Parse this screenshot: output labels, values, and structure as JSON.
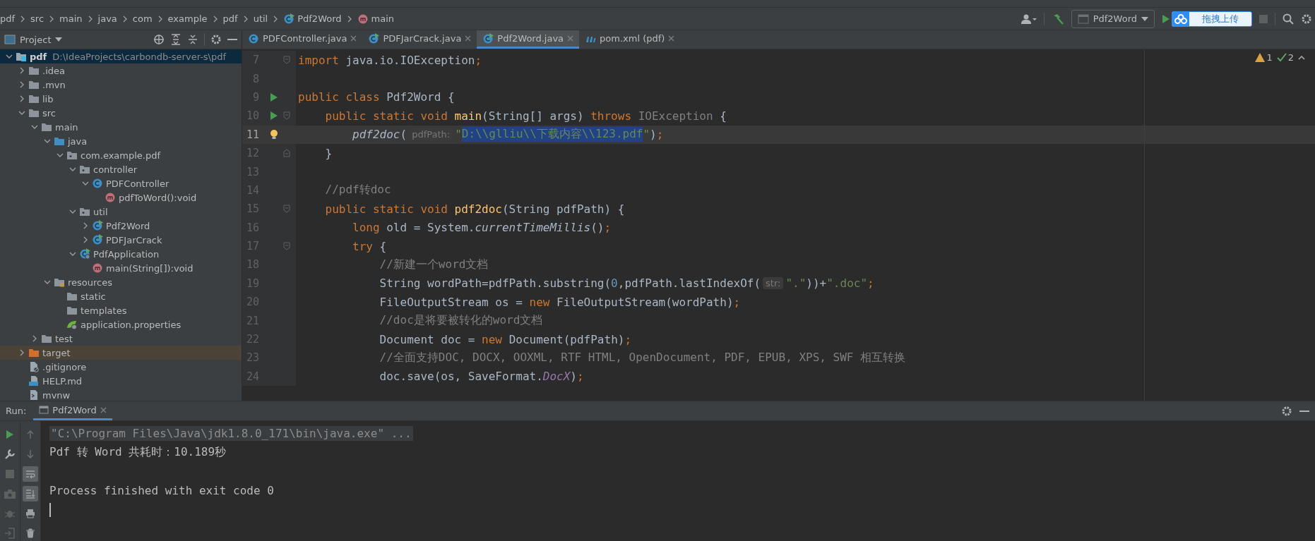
{
  "breadcrumbs": [
    {
      "label": "pdf",
      "kind": "plain"
    },
    {
      "label": "src",
      "kind": "plain"
    },
    {
      "label": "main",
      "kind": "plain"
    },
    {
      "label": "java",
      "kind": "plain"
    },
    {
      "label": "com",
      "kind": "plain"
    },
    {
      "label": "example",
      "kind": "plain"
    },
    {
      "label": "pdf",
      "kind": "plain"
    },
    {
      "label": "util",
      "kind": "plain"
    },
    {
      "label": "Pdf2Word",
      "kind": "runnable-class"
    },
    {
      "label": "main",
      "kind": "method"
    }
  ],
  "toolbar": {
    "run_config": "Pdf2Word",
    "upload_button": "拖拽上传"
  },
  "project_panel": {
    "title": "Project",
    "tree": [
      {
        "label": "pdf",
        "path": "D:\\IdeaProjects\\carbondb-server-s\\pdf",
        "kind": "module",
        "expanded": true,
        "selected": true,
        "children": [
          {
            "label": ".idea",
            "kind": "folder",
            "expanded": false,
            "selected": false
          },
          {
            "label": ".mvn",
            "kind": "folder",
            "expanded": false,
            "selected": false
          },
          {
            "label": "lib",
            "kind": "folder",
            "expanded": false,
            "selected": false
          },
          {
            "label": "src",
            "kind": "folder",
            "expanded": true,
            "selected": false,
            "children": [
              {
                "label": "main",
                "kind": "folder",
                "expanded": true,
                "selected": false,
                "children": [
                  {
                    "label": "java",
                    "kind": "source-folder",
                    "expanded": true,
                    "selected": false,
                    "children": [
                      {
                        "label": "com.example.pdf",
                        "kind": "package",
                        "expanded": true,
                        "selected": false,
                        "children": [
                          {
                            "label": "controller",
                            "kind": "package",
                            "expanded": true,
                            "selected": false,
                            "children": [
                              {
                                "label": "PDFController",
                                "kind": "class",
                                "expanded": true,
                                "selected": false,
                                "children": [
                                  {
                                    "label": "pdfToWord():void",
                                    "kind": "method",
                                    "selected": false
                                  }
                                ]
                              }
                            ]
                          },
                          {
                            "label": "util",
                            "kind": "package",
                            "expanded": true,
                            "selected": false,
                            "children": [
                              {
                                "label": "Pdf2Word",
                                "kind": "runnable-class",
                                "expanded": false,
                                "selected": false
                              },
                              {
                                "label": "PDFJarCrack",
                                "kind": "runnable-class",
                                "expanded": false,
                                "selected": false
                              }
                            ]
                          },
                          {
                            "label": "PdfApplication",
                            "kind": "spring-class",
                            "expanded": true,
                            "selected": false,
                            "children": [
                              {
                                "label": "main(String[]):void",
                                "kind": "method",
                                "selected": false
                              }
                            ]
                          }
                        ]
                      }
                    ]
                  },
                  {
                    "label": "resources",
                    "kind": "resources-folder",
                    "expanded": true,
                    "selected": false,
                    "children": [
                      {
                        "label": "static",
                        "kind": "folder",
                        "selected": false
                      },
                      {
                        "label": "templates",
                        "kind": "folder",
                        "selected": false
                      },
                      {
                        "label": "application.properties",
                        "kind": "properties",
                        "selected": false
                      }
                    ]
                  }
                ]
              },
              {
                "label": "test",
                "kind": "folder",
                "expanded": false,
                "selected": false
              }
            ]
          },
          {
            "label": "target",
            "kind": "excluded-folder",
            "expanded": false,
            "selected": false
          },
          {
            "label": ".gitignore",
            "kind": "ignore-file",
            "selected": false
          },
          {
            "label": "HELP.md",
            "kind": "markdown",
            "selected": false
          },
          {
            "label": "mvnw",
            "kind": "script",
            "selected": false
          }
        ]
      }
    ]
  },
  "editor_tabs": [
    {
      "label": "PDFController.java",
      "kind": "class",
      "selected": false
    },
    {
      "label": "PDFJarCrack.java",
      "kind": "runnable-class",
      "selected": false
    },
    {
      "label": "Pdf2Word.java",
      "kind": "runnable-class",
      "selected": true
    },
    {
      "label": "pom.xml (pdf)",
      "kind": "maven",
      "selected": false
    }
  ],
  "inspections": {
    "warnings": "1",
    "weak_warnings": "2"
  },
  "editor": {
    "lines": [
      {
        "number": "7",
        "fold_start": true,
        "current": false,
        "tokens": [
          {
            "text": "import",
            "kind": "keyword"
          },
          {
            "text": " java.io.IOException",
            "kind": "plain"
          },
          {
            "text": ";",
            "kind": "keyword"
          }
        ]
      },
      {
        "number": "8",
        "current": false
      },
      {
        "number": "9",
        "run": true,
        "current": false,
        "tokens": [
          {
            "text": "public class",
            "kind": "keyword"
          },
          {
            "text": " Pdf2Word {",
            "kind": "plain"
          }
        ]
      },
      {
        "number": "10",
        "run": true,
        "fold_start": true,
        "current": false,
        "tokens": [
          {
            "text": "    public static void",
            "kind": "keyword"
          },
          {
            "text": " main",
            "kind": "declaration"
          },
          {
            "text": "(String[] args) ",
            "kind": "plain"
          },
          {
            "text": "throws",
            "kind": "keyword"
          },
          {
            "text": " IOException",
            "kind": "unused"
          },
          {
            "text": " {",
            "kind": "plain"
          }
        ]
      },
      {
        "number": "11",
        "bulb": true,
        "current": true,
        "tokens": [
          {
            "text": "        pdf2doc",
            "kind": "static-call"
          },
          {
            "text": "(",
            "kind": "plain"
          },
          {
            "text": "pdfPath:",
            "kind": "hint"
          },
          {
            "text": "\"",
            "kind": "string"
          },
          {
            "text": "D:\\\\glliu\\\\下载内容\\\\123.pdf",
            "kind": "string",
            "selected": true
          },
          {
            "text": "\"",
            "kind": "string"
          },
          {
            "text": ")",
            "kind": "plain"
          },
          {
            "text": ";",
            "kind": "keyword"
          }
        ]
      },
      {
        "number": "12",
        "fold_end": true,
        "current": false,
        "tokens": [
          {
            "text": "    }",
            "kind": "plain"
          }
        ]
      },
      {
        "number": "13",
        "current": false
      },
      {
        "number": "14",
        "current": false,
        "tokens": [
          {
            "text": "    //pdf转doc",
            "kind": "comment"
          }
        ]
      },
      {
        "number": "15",
        "fold_start": true,
        "current": false,
        "tokens": [
          {
            "text": "    public static void",
            "kind": "keyword"
          },
          {
            "text": " pdf2doc",
            "kind": "declaration"
          },
          {
            "text": "(String pdfPath) {",
            "kind": "plain"
          }
        ]
      },
      {
        "number": "16",
        "current": false,
        "tokens": [
          {
            "text": "        long",
            "kind": "keyword"
          },
          {
            "text": " old = System.",
            "kind": "plain"
          },
          {
            "text": "currentTimeMillis",
            "kind": "static-call"
          },
          {
            "text": "()",
            "kind": "plain"
          },
          {
            "text": ";",
            "kind": "keyword"
          }
        ]
      },
      {
        "number": "17",
        "fold_start": true,
        "current": false,
        "tokens": [
          {
            "text": "        try",
            "kind": "keyword"
          },
          {
            "text": " {",
            "kind": "plain"
          }
        ]
      },
      {
        "number": "18",
        "current": false,
        "tokens": [
          {
            "text": "            //新建一个word文档",
            "kind": "comment"
          }
        ]
      },
      {
        "number": "19",
        "current": false,
        "tokens": [
          {
            "text": "            String wordPath=pdfPath.substring(",
            "kind": "plain"
          },
          {
            "text": "0",
            "kind": "number"
          },
          {
            "text": ",pdfPath.lastIndexOf(",
            "kind": "plain"
          },
          {
            "text": "str:",
            "kind": "hint"
          },
          {
            "text": "\".\"",
            "kind": "string"
          },
          {
            "text": "))+",
            "kind": "plain"
          },
          {
            "text": "\".doc\"",
            "kind": "string"
          },
          {
            "text": ";",
            "kind": "keyword"
          }
        ]
      },
      {
        "number": "20",
        "current": false,
        "tokens": [
          {
            "text": "            FileOutputStream os = ",
            "kind": "plain"
          },
          {
            "text": "new",
            "kind": "keyword"
          },
          {
            "text": " FileOutputStream(wordPath)",
            "kind": "plain"
          },
          {
            "text": ";",
            "kind": "keyword"
          }
        ]
      },
      {
        "number": "21",
        "current": false,
        "tokens": [
          {
            "text": "            //doc是将要被转化的word文档",
            "kind": "comment"
          }
        ]
      },
      {
        "number": "22",
        "current": false,
        "tokens": [
          {
            "text": "            Document doc = ",
            "kind": "plain"
          },
          {
            "text": "new",
            "kind": "keyword"
          },
          {
            "text": " Document(pdfPath)",
            "kind": "plain"
          },
          {
            "text": ";",
            "kind": "keyword"
          }
        ]
      },
      {
        "number": "23",
        "current": false,
        "tokens": [
          {
            "text": "            //全面支持DOC, DOCX, OOXML, RTF HTML, OpenDocument, PDF, EPUB, XPS, SWF 相互转换",
            "kind": "comment"
          }
        ]
      },
      {
        "number": "24",
        "current": false,
        "tokens": [
          {
            "text": "            doc.save(os, SaveFormat.",
            "kind": "plain"
          },
          {
            "text": "DocX",
            "kind": "constant"
          },
          {
            "text": ")",
            "kind": "plain"
          },
          {
            "text": ";",
            "kind": "keyword"
          }
        ]
      }
    ]
  },
  "run_panel": {
    "label": "Run:",
    "tab": "Pdf2Word",
    "toolbar": [
      {
        "kind": "up",
        "on": false
      },
      {
        "kind": "down",
        "on": false
      },
      {
        "kind": "soft-wrap",
        "on": true
      },
      {
        "kind": "scroll-end",
        "on": true
      },
      {
        "kind": "print",
        "on": false
      },
      {
        "kind": "trash",
        "on": false
      }
    ],
    "console": [
      {
        "kind": "command",
        "text": "\"C:\\Program Files\\Java\\jdk1.8.0_171\\bin\\java.exe\" ..."
      },
      {
        "kind": "output",
        "text": "Pdf 转 Word 共耗时：10.189秒"
      },
      {
        "kind": "exit",
        "text": "Process finished with exit code 0"
      }
    ]
  }
}
